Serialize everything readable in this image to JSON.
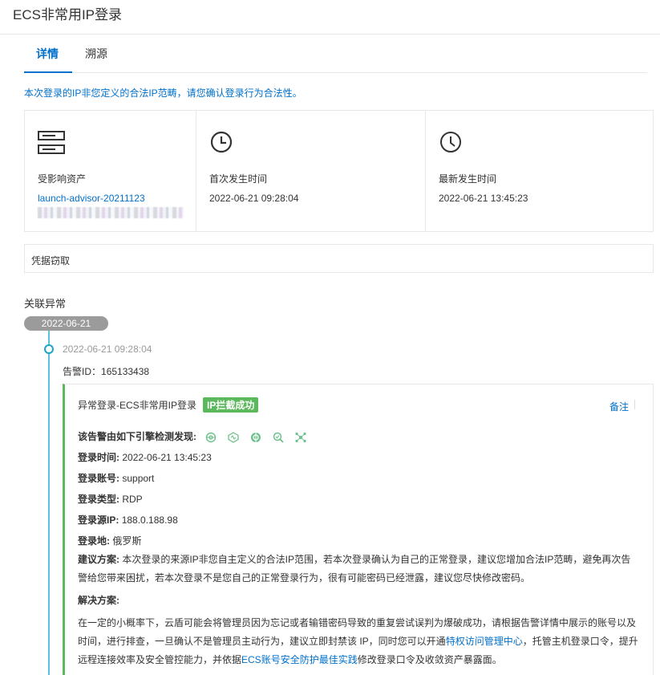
{
  "page": {
    "title": "ECS非常用IP登录"
  },
  "tabs": [
    {
      "label": "详情",
      "active": true
    },
    {
      "label": "溯源",
      "active": false
    }
  ],
  "notice": "本次登录的IP非您定义的合法IP范畴，请您确认登录行为合法性。",
  "cards": {
    "asset": {
      "label": "受影响资产",
      "link": "launch-advisor-20211123",
      "icon": "server-icon"
    },
    "first": {
      "label": "首次发生时间",
      "value": "2022-06-21 09:28:04",
      "icon": "clock-icon"
    },
    "latest": {
      "label": "最新发生时间",
      "value": "2022-06-21 13:45:23",
      "icon": "clock-icon"
    }
  },
  "credential": "凭据窃取",
  "related": {
    "title": "关联异常",
    "date": "2022-06-21",
    "event_time": "2022-06-21 09:28:04",
    "alert_id_label": "告警ID：",
    "alert_id": "165133438"
  },
  "detail": {
    "title": "异常登录-ECS非常用IP登录",
    "badge": "IP拦截成功",
    "note": "备注",
    "engines_label": "该告警由如下引擎检测发现:",
    "engine_icons": [
      "engine-icon-1",
      "engine-icon-2",
      "engine-icon-3",
      "engine-icon-4",
      "engine-icon-5"
    ],
    "login_time_label": "登录时间:",
    "login_time": "2022-06-21 13:45:23",
    "account_label": "登录账号:",
    "account": "support",
    "type_label": "登录类型:",
    "type": "RDP",
    "source_ip_label": "登录源IP:",
    "source_ip": "188.0.188.98",
    "location_label": "登录地:",
    "location": "俄罗斯",
    "advice_label": "建议方案:",
    "advice": "本次登录的来源IP非您自主定义的合法IP范围，若本次登录确认为自己的正常登录，建议您增加合法IP范畴，避免再次告警给您带来困扰，若本次登录不是您自己的正常登录行为，很有可能密码已经泄露，建议您尽快修改密码。",
    "solution_label": "解决方案:",
    "solution_part1": "在一定的小概率下，云盾可能会将管理员因为忘记或者输错密码导致的重复尝试误判为爆破成功，请根据告警详情中展示的账号以及时间，进行排查，一旦确认不是管理员主动行为，建议立即封禁该 IP，同时您可以开通",
    "solution_link1": "特权访问管理中心",
    "solution_part2": "，托管主机登录口令，提升远程连接效率及安全管控能力，并依据",
    "solution_link2": "ECS账号安全防护最佳实践",
    "solution_part3": "修改登录口令及收敛资产暴露面。"
  },
  "colors": {
    "accent": "#0070cc",
    "success": "#5cb85c",
    "timeline": "#1ba5c9",
    "pill": "#9b9b9b"
  }
}
